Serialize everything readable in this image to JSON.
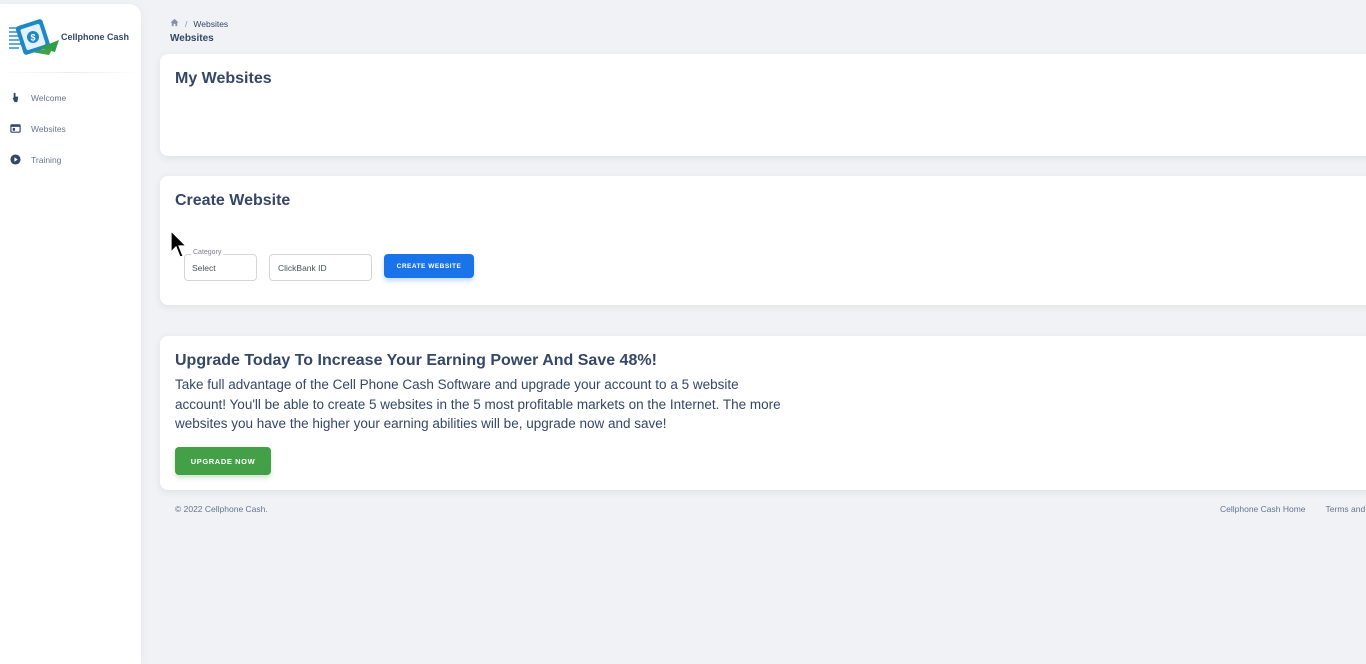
{
  "brand": {
    "name": "Cellphone Cash"
  },
  "sidebar": {
    "items": [
      {
        "label": "Welcome",
        "icon": "hand-wave-icon"
      },
      {
        "label": "Websites",
        "icon": "web-icon"
      },
      {
        "label": "Training",
        "icon": "play-circle-icon"
      }
    ]
  },
  "breadcrumb": {
    "current": "Websites"
  },
  "page": {
    "title": "Websites"
  },
  "my_websites": {
    "title": "My Websites"
  },
  "create_website": {
    "title": "Create Website",
    "category_label": "Category",
    "category_value": "Select",
    "clickbank_placeholder": "ClickBank ID",
    "button_label": "Create Website"
  },
  "upgrade": {
    "title": "Upgrade Today To Increase Your Earning Power And Save 48%!",
    "text": "Take full advantage of the Cell Phone Cash Software and upgrade your account to a 5 website account! You'll be able to create 5 websites in the 5 most profitable markets on the Internet. The more websites you have the higher your earning abilities will be, upgrade now and save!",
    "button_label": "Upgrade Now"
  },
  "footer": {
    "copyright": "© 2022 Cellphone Cash.",
    "links": [
      "Cellphone Cash Home",
      "Terms and"
    ]
  },
  "colors": {
    "primary": "#1a73e8",
    "success": "#43a047",
    "text": "#344767",
    "muted": "#67748e"
  }
}
